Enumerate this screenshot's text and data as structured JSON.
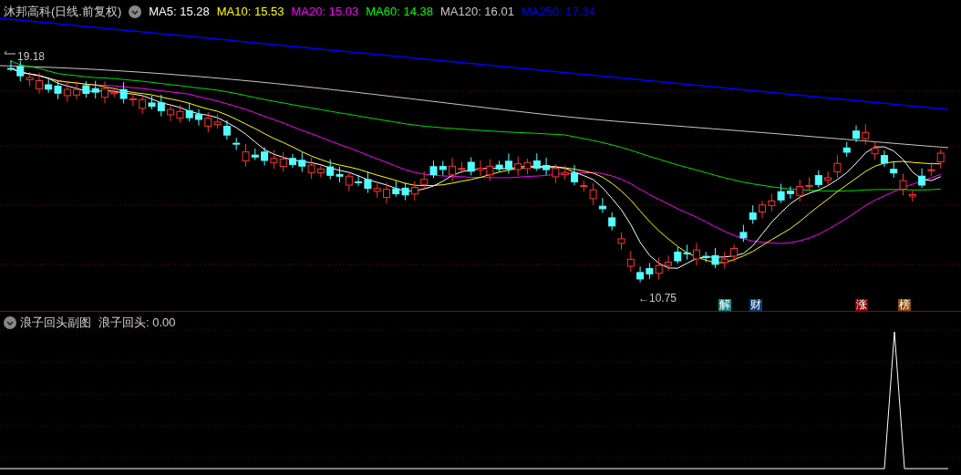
{
  "stock_header": {
    "title": "沐邦高科(日线.前复权)",
    "indicators": [
      {
        "label": "MA5: 15.28",
        "color": "#ffffff"
      },
      {
        "label": "MA10: 15.53",
        "color": "#ffff00"
      },
      {
        "label": "MA20: 15.03",
        "color": "#ff00ff"
      },
      {
        "label": "MA60: 14.38",
        "color": "#00ff00"
      },
      {
        "label": "MA120: 16.01",
        "color": "#c8c8c8"
      },
      {
        "label": "MA250: 17.34",
        "color": "#0000ff"
      }
    ]
  },
  "price_chart": {
    "high_label": "19.18",
    "low_label": "←10.75",
    "event_markers": [
      {
        "label": "解",
        "color": "#0e8a8a"
      },
      {
        "label": "财",
        "color": "#0b3f78"
      },
      {
        "label": "涨",
        "color": "#8a0000"
      },
      {
        "label": "榜",
        "color": "#8a4a0a"
      }
    ]
  },
  "sub_chart": {
    "title": "浪子回头副图",
    "indicator": "浪子回头: 0.00"
  }
}
